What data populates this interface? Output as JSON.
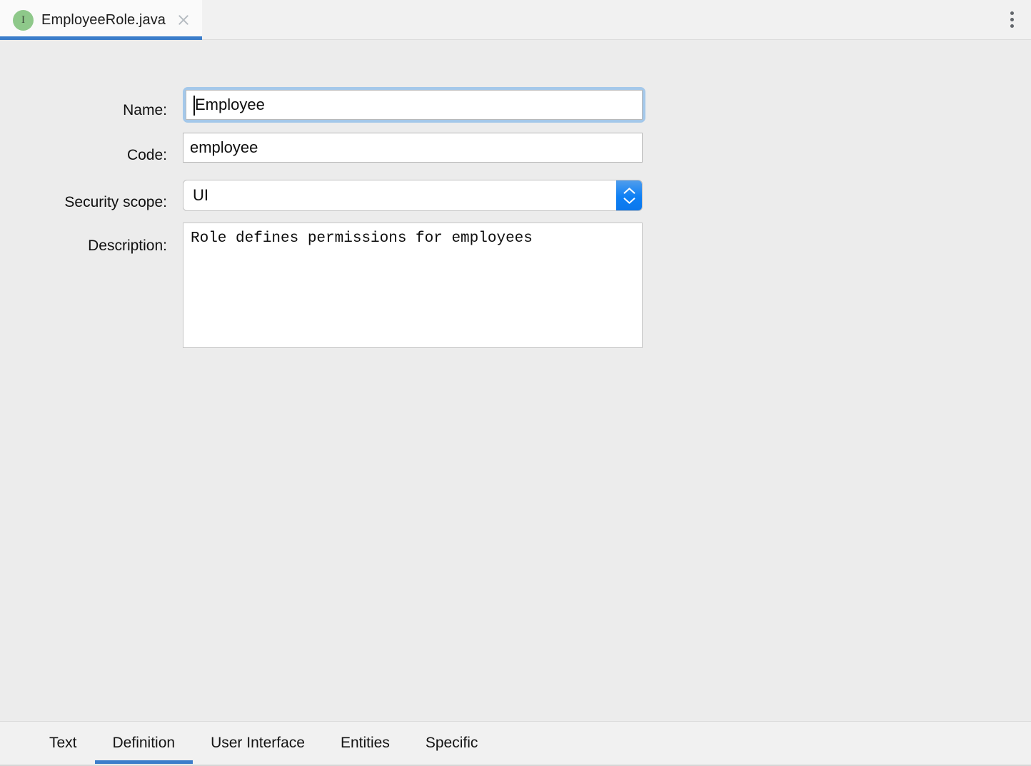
{
  "colors": {
    "accent": "#3b7dca",
    "focus_ring": "#a4c8ea",
    "stepper_blue": "#0e80f5",
    "tab_icon_green": "#8ec88a",
    "window_background": "#ececec",
    "tabbar_background": "#f1f1f1",
    "active_tab_background": "#fafafa"
  },
  "editor_tabs": {
    "open_file": {
      "icon": "interface-java-icon",
      "icon_letter": "I",
      "title": "EmployeeRole.java",
      "close_icon": "close-icon",
      "active": true
    },
    "options_icon": "more-vertical-icon"
  },
  "form": {
    "fields": [
      {
        "id": "name",
        "label": "Name:",
        "type": "text",
        "value": "Employee",
        "focused": true,
        "caret": true
      },
      {
        "id": "code",
        "label": "Code:",
        "type": "text",
        "value": "employee",
        "focused": false
      },
      {
        "id": "security_scope",
        "label": "Security scope:",
        "type": "select",
        "value": "UI",
        "stepper_icon": "stepper-up-down-icon"
      },
      {
        "id": "description",
        "label": "Description:",
        "type": "textarea",
        "value": "Role defines permissions for employees"
      }
    ]
  },
  "bottom_tabs": {
    "items": [
      {
        "label": "Text",
        "active": false
      },
      {
        "label": "Definition",
        "active": true
      },
      {
        "label": "User Interface",
        "active": false
      },
      {
        "label": "Entities",
        "active": false
      },
      {
        "label": "Specific",
        "active": false
      }
    ]
  }
}
